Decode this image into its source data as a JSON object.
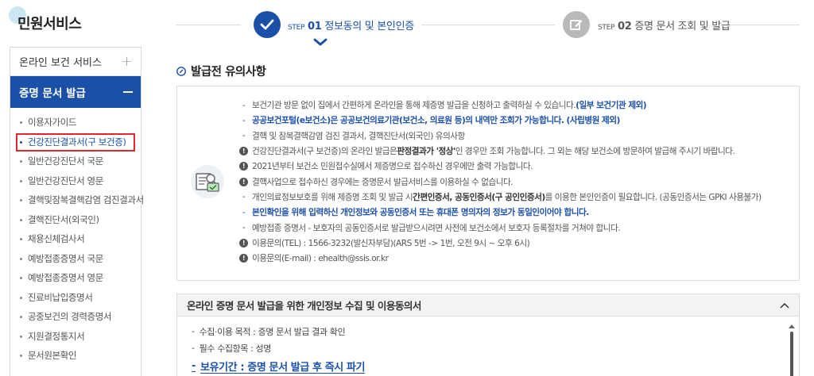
{
  "sidebar": {
    "title": "민원서비스",
    "menu_top_label": "온라인 보건 서비스",
    "menu_active_label": "증명 문서 발급",
    "items": [
      {
        "label": "이용자가이드"
      },
      {
        "label": "건강진단결과서(구 보건증)"
      },
      {
        "label": "일반건강진단서 국문"
      },
      {
        "label": "일반건강진단서 영문"
      },
      {
        "label": "결핵및잠복결핵감염 검진결과서"
      },
      {
        "label": "결핵진단서(외국인)"
      },
      {
        "label": "채용신체검사서"
      },
      {
        "label": "예방접종증명서 국문"
      },
      {
        "label": "예방접종증명서 영문"
      },
      {
        "label": "진료비납입증명서"
      },
      {
        "label": "공중보건의 경력증명서"
      },
      {
        "label": "지원결정통지서"
      },
      {
        "label": "문서원본확인"
      }
    ]
  },
  "steps": {
    "step1": {
      "prefix": "STEP",
      "num": "01",
      "label": "정보동의 및 본인인증"
    },
    "step2": {
      "prefix": "STEP",
      "num": "02",
      "label": "증명 문서 조회 및 발급"
    }
  },
  "notice": {
    "heading": "발급전 유의사항",
    "lines": {
      "l1a": "보건기관 방문 없이 집에서 간편하게 온라인을 통해 제증명 발급을 신청하고 출력하실 수 있습니다.",
      "l1b": "(일부 보건기관 제외)",
      "l2": "공공보건포털(e보건소)은 공공보건의료기관(보건소, 의료원 등)의 내역만 조회가 가능합니다. (사립병원 제외)",
      "l3": "결핵 및 잠복결핵감염 검진 결과서, 결핵진단서(외국인) 유의사항",
      "l4a": "건강진단결과서(구 보건증)의 온라인 발급은 ",
      "l4b": "판정결과가 '정상'",
      "l4c": "인 경우만 조회 가능합니다. 그 외는 해당 보건소에 방문하여 발급해 주시기 바랍니다.",
      "l5": "2021년부터 보건소 민원접수실에서 제증명으로 접수하신 경우에만 출력 가능합니다.",
      "l6": "결핵사업으로 접수하신 경우에는 증명문서 발급서비스를 이용하실 수 없습니다.",
      "l7a": "개인의료정보보호를 위해 제증명 조회 및 발급 시 ",
      "l7b": "간편인증서, 공동인증서(구 공인인증서)",
      "l7c": "를 이용한 본인인증이 필요합니다. (공동인증서는 GPKI 사용불가)",
      "l8": "본인확인을 위해 입력하신 개인정보와 공동인증서 또는 휴대폰 명의자의 정보가 동일인이어야 합니다.",
      "l9": "예방접종 증명서 - 보호자의 공동인증서로 발급받으시려면 사전에 보건소에서 보호자 등록절차를 거쳐야 합니다.",
      "l10": "이용문의(TEL) : 1566-3232(발신자부담)(ARS 5번 -> 1번, 오전 9시 ~ 오후 6시)",
      "l11": "이용문의(E-mail) : ehealth@ssis.or.kr"
    }
  },
  "consent": {
    "title": "온라인 증명 문서 발급을 위한 개인정보 수집 및 이용동의서",
    "line1": "수집·이용 목적 : 증명 문서 발급 결과 확인",
    "line2": "필수 수집항목 : 성명",
    "line3": "보유기간 : 증명 문서 발급 후 즉시 파기"
  },
  "colors": {
    "primary": "#1b50a8",
    "highlight_box": "#e3262b",
    "step_inactive": "#b9b9b9"
  },
  "icons": {
    "step1": "check-icon",
    "step2": "pencil-icon",
    "step_current": "chevron-down-icon",
    "heading": "pencil-circle-icon",
    "notice": "document-search-icon",
    "collapse": "chevron-up-icon"
  }
}
